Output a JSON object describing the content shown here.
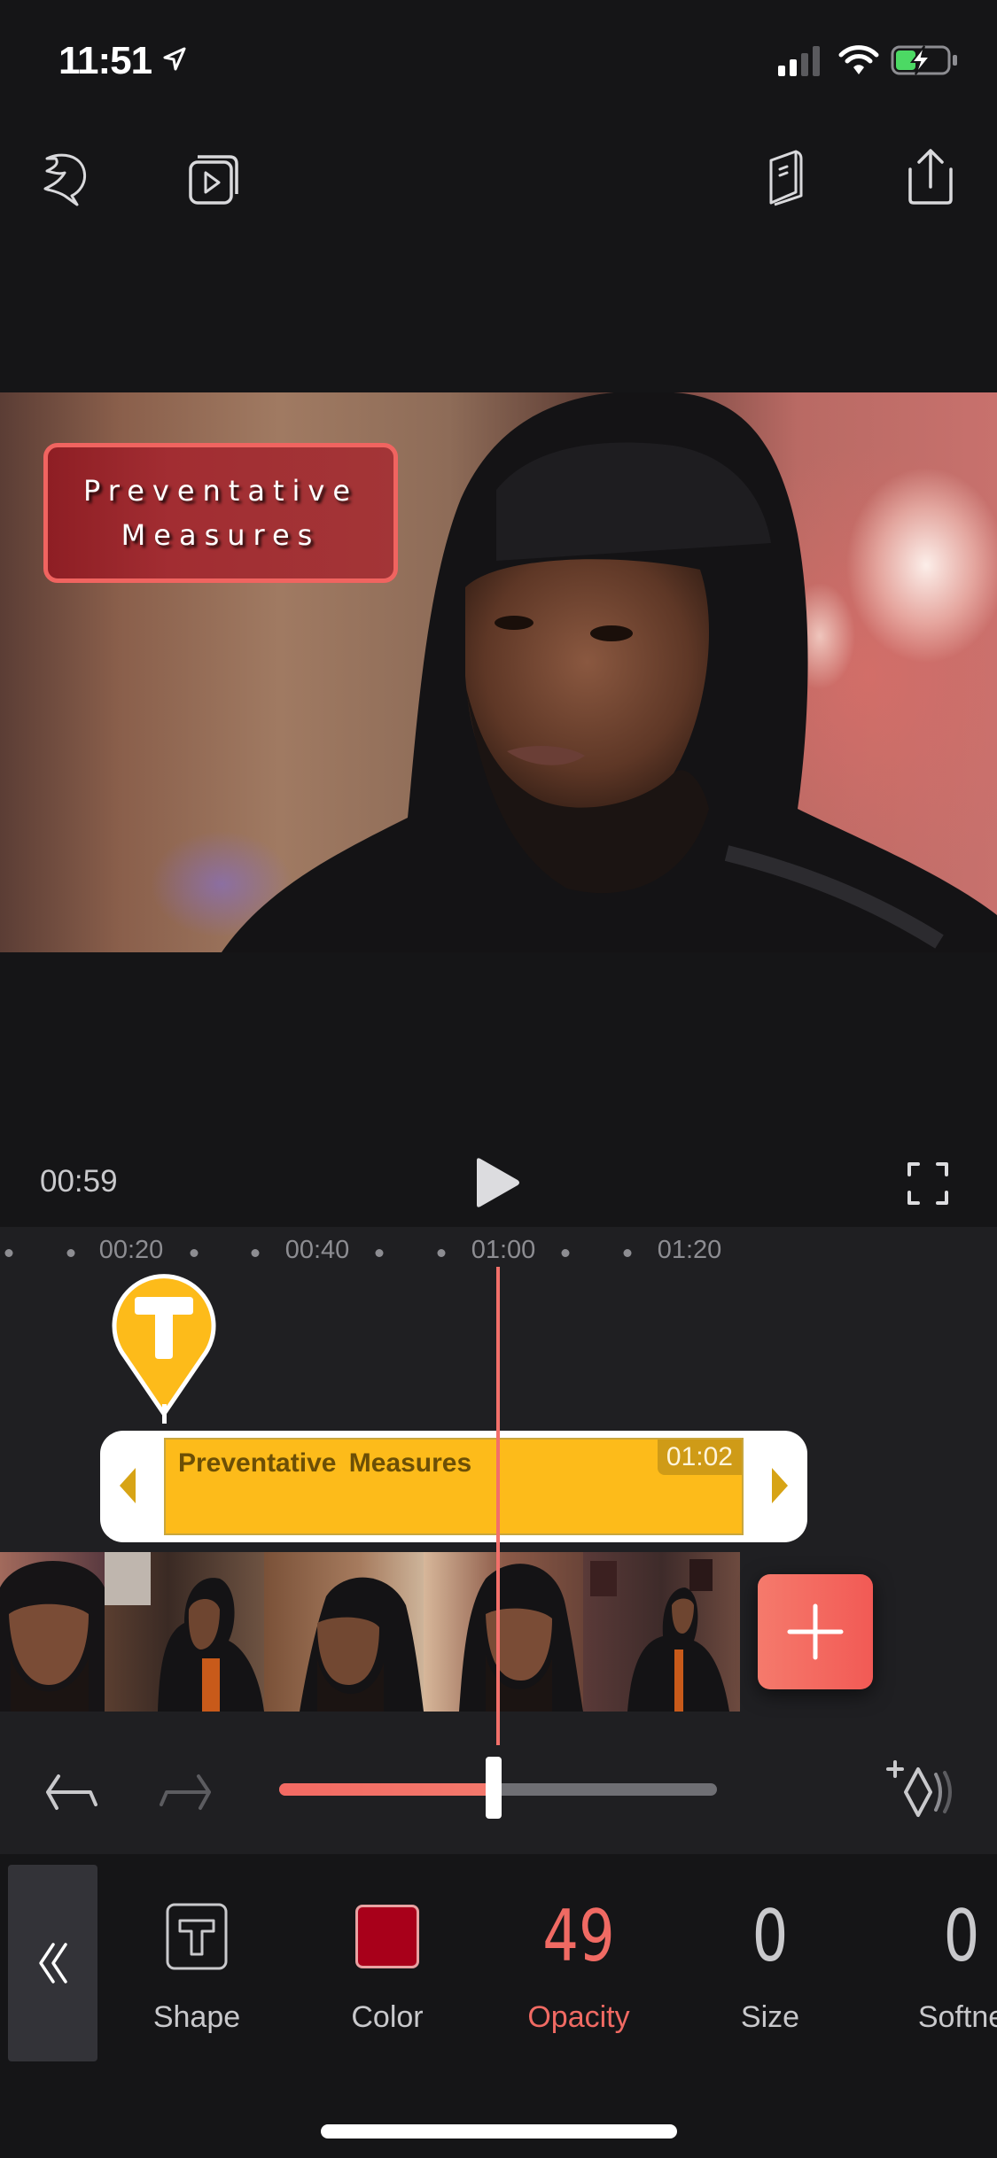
{
  "status_bar": {
    "time": "11:51",
    "icons": [
      "location-arrow-icon",
      "cellular-signal-icon",
      "wifi-icon",
      "battery-charging-icon"
    ],
    "battery_color": "#4cd964"
  },
  "toolbar": {
    "left": [
      {
        "name": "app-logo-icon",
        "label": "Logo"
      },
      {
        "name": "preview-projects-icon",
        "label": "Projects"
      }
    ],
    "right": [
      {
        "name": "guide-book-icon",
        "label": "Guide"
      },
      {
        "name": "share-export-icon",
        "label": "Export"
      }
    ]
  },
  "preview": {
    "overlay_text": {
      "line1": "Preventative",
      "line2": "Measures",
      "box_fill": "#a22d32",
      "border_color": "#f06460"
    }
  },
  "playback": {
    "current_time": "00:59",
    "play_icon": "play-icon",
    "fullscreen_icon": "fullscreen-icon"
  },
  "timeline": {
    "ruler_labels": [
      "00:20",
      "00:40",
      "01:00",
      "01:20"
    ],
    "text_marker_glyph": "T",
    "text_clip": {
      "title": "Preventative  Measures",
      "duration": "01:02"
    },
    "add_clip_icon": "plus-icon",
    "zoom_slider_value": 0.49,
    "undo_icon": "undo-icon",
    "redo_icon": "redo-icon",
    "keyframe_icon": "add-keyframe-icon"
  },
  "properties": {
    "collapse_icon": "double-chevron-left-icon",
    "items": [
      {
        "key": "shape",
        "label": "Shape",
        "type": "icon"
      },
      {
        "key": "color",
        "label": "Color",
        "type": "swatch",
        "value": "#a8001a"
      },
      {
        "key": "opacity",
        "label": "Opacity",
        "type": "number",
        "value": "49",
        "active": true
      },
      {
        "key": "size",
        "label": "Size",
        "type": "number",
        "value": "0"
      },
      {
        "key": "softness",
        "label": "Softne",
        "type": "number",
        "value": "0"
      }
    ],
    "active_color": "#f06a63"
  }
}
